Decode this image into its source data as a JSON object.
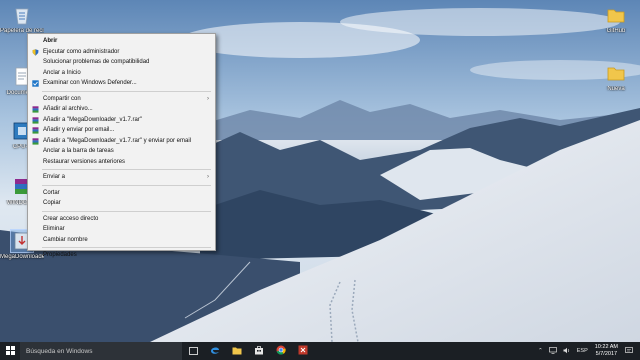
{
  "desktop": {
    "icons": [
      {
        "label": "Papelera de reciclaje",
        "icon": "recycle-bin-icon"
      },
      {
        "label": "Documento",
        "icon": "document-icon"
      },
      {
        "label": "CPU-Z",
        "icon": "cpuz-icon"
      },
      {
        "label": "WINDOWS",
        "icon": "winrar-icon"
      },
      {
        "label": "MegaDownloader v1.7",
        "icon": "megadownloader-icon"
      },
      {
        "label": "GitHub",
        "icon": "folder-icon"
      },
      {
        "label": "Nueva",
        "icon": "folder-icon"
      }
    ]
  },
  "context_menu": {
    "items": [
      {
        "label": "Abrir",
        "bold": true
      },
      {
        "label": "Ejecutar como administrador",
        "icon": "shield-icon"
      },
      {
        "label": "Solucionar problemas de compatibilidad"
      },
      {
        "label": "Anclar a Inicio"
      },
      {
        "label": "Examinar con Windows Defender...",
        "icon": "defender-icon"
      },
      {
        "label": "Compartir con",
        "submenu": true
      },
      {
        "label": "Añadir al archivo...",
        "icon": "winrar-icon"
      },
      {
        "label": "Añadir a \"MegaDownloader_v1.7.rar\"",
        "icon": "winrar-icon"
      },
      {
        "label": "Añadir y enviar por email...",
        "icon": "winrar-icon"
      },
      {
        "label": "Añadir a \"MegaDownloader_v1.7.rar\" y enviar por email",
        "icon": "winrar-icon"
      },
      {
        "label": "Anclar a la barra de tareas"
      },
      {
        "label": "Restaurar versiones anteriores"
      },
      {
        "label": "Enviar a",
        "submenu": true
      },
      {
        "label": "Cortar"
      },
      {
        "label": "Copiar"
      },
      {
        "label": "Crear acceso directo"
      },
      {
        "label": "Eliminar"
      },
      {
        "label": "Cambiar nombre"
      },
      {
        "label": "Propiedades"
      }
    ]
  },
  "taskbar": {
    "search_placeholder": "Búsqueda en Windows",
    "language": "ESP",
    "time": "10:22 AM",
    "date": "5/7/2017"
  },
  "colors": {
    "taskbar": "#1b1f24",
    "menu_bg": "#f2f2f2",
    "accent": "#0078d7"
  }
}
